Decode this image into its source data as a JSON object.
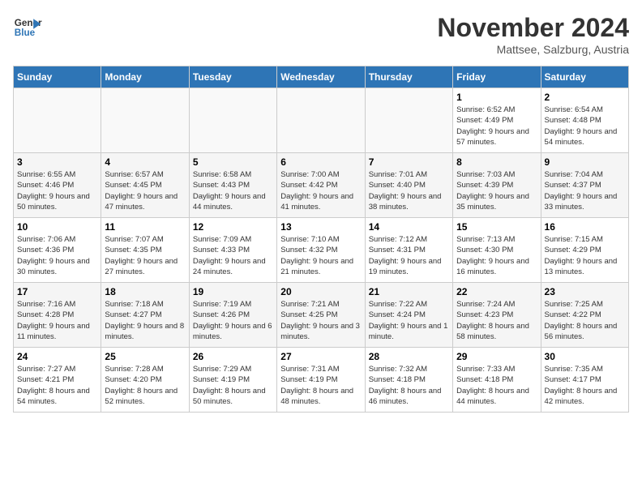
{
  "header": {
    "logo_line1": "General",
    "logo_line2": "Blue",
    "month_year": "November 2024",
    "location": "Mattsee, Salzburg, Austria"
  },
  "weekdays": [
    "Sunday",
    "Monday",
    "Tuesday",
    "Wednesday",
    "Thursday",
    "Friday",
    "Saturday"
  ],
  "weeks": [
    [
      {
        "day": "",
        "info": ""
      },
      {
        "day": "",
        "info": ""
      },
      {
        "day": "",
        "info": ""
      },
      {
        "day": "",
        "info": ""
      },
      {
        "day": "",
        "info": ""
      },
      {
        "day": "1",
        "info": "Sunrise: 6:52 AM\nSunset: 4:49 PM\nDaylight: 9 hours and 57 minutes."
      },
      {
        "day": "2",
        "info": "Sunrise: 6:54 AM\nSunset: 4:48 PM\nDaylight: 9 hours and 54 minutes."
      }
    ],
    [
      {
        "day": "3",
        "info": "Sunrise: 6:55 AM\nSunset: 4:46 PM\nDaylight: 9 hours and 50 minutes."
      },
      {
        "day": "4",
        "info": "Sunrise: 6:57 AM\nSunset: 4:45 PM\nDaylight: 9 hours and 47 minutes."
      },
      {
        "day": "5",
        "info": "Sunrise: 6:58 AM\nSunset: 4:43 PM\nDaylight: 9 hours and 44 minutes."
      },
      {
        "day": "6",
        "info": "Sunrise: 7:00 AM\nSunset: 4:42 PM\nDaylight: 9 hours and 41 minutes."
      },
      {
        "day": "7",
        "info": "Sunrise: 7:01 AM\nSunset: 4:40 PM\nDaylight: 9 hours and 38 minutes."
      },
      {
        "day": "8",
        "info": "Sunrise: 7:03 AM\nSunset: 4:39 PM\nDaylight: 9 hours and 35 minutes."
      },
      {
        "day": "9",
        "info": "Sunrise: 7:04 AM\nSunset: 4:37 PM\nDaylight: 9 hours and 33 minutes."
      }
    ],
    [
      {
        "day": "10",
        "info": "Sunrise: 7:06 AM\nSunset: 4:36 PM\nDaylight: 9 hours and 30 minutes."
      },
      {
        "day": "11",
        "info": "Sunrise: 7:07 AM\nSunset: 4:35 PM\nDaylight: 9 hours and 27 minutes."
      },
      {
        "day": "12",
        "info": "Sunrise: 7:09 AM\nSunset: 4:33 PM\nDaylight: 9 hours and 24 minutes."
      },
      {
        "day": "13",
        "info": "Sunrise: 7:10 AM\nSunset: 4:32 PM\nDaylight: 9 hours and 21 minutes."
      },
      {
        "day": "14",
        "info": "Sunrise: 7:12 AM\nSunset: 4:31 PM\nDaylight: 9 hours and 19 minutes."
      },
      {
        "day": "15",
        "info": "Sunrise: 7:13 AM\nSunset: 4:30 PM\nDaylight: 9 hours and 16 minutes."
      },
      {
        "day": "16",
        "info": "Sunrise: 7:15 AM\nSunset: 4:29 PM\nDaylight: 9 hours and 13 minutes."
      }
    ],
    [
      {
        "day": "17",
        "info": "Sunrise: 7:16 AM\nSunset: 4:28 PM\nDaylight: 9 hours and 11 minutes."
      },
      {
        "day": "18",
        "info": "Sunrise: 7:18 AM\nSunset: 4:27 PM\nDaylight: 9 hours and 8 minutes."
      },
      {
        "day": "19",
        "info": "Sunrise: 7:19 AM\nSunset: 4:26 PM\nDaylight: 9 hours and 6 minutes."
      },
      {
        "day": "20",
        "info": "Sunrise: 7:21 AM\nSunset: 4:25 PM\nDaylight: 9 hours and 3 minutes."
      },
      {
        "day": "21",
        "info": "Sunrise: 7:22 AM\nSunset: 4:24 PM\nDaylight: 9 hours and 1 minute."
      },
      {
        "day": "22",
        "info": "Sunrise: 7:24 AM\nSunset: 4:23 PM\nDaylight: 8 hours and 58 minutes."
      },
      {
        "day": "23",
        "info": "Sunrise: 7:25 AM\nSunset: 4:22 PM\nDaylight: 8 hours and 56 minutes."
      }
    ],
    [
      {
        "day": "24",
        "info": "Sunrise: 7:27 AM\nSunset: 4:21 PM\nDaylight: 8 hours and 54 minutes."
      },
      {
        "day": "25",
        "info": "Sunrise: 7:28 AM\nSunset: 4:20 PM\nDaylight: 8 hours and 52 minutes."
      },
      {
        "day": "26",
        "info": "Sunrise: 7:29 AM\nSunset: 4:19 PM\nDaylight: 8 hours and 50 minutes."
      },
      {
        "day": "27",
        "info": "Sunrise: 7:31 AM\nSunset: 4:19 PM\nDaylight: 8 hours and 48 minutes."
      },
      {
        "day": "28",
        "info": "Sunrise: 7:32 AM\nSunset: 4:18 PM\nDaylight: 8 hours and 46 minutes."
      },
      {
        "day": "29",
        "info": "Sunrise: 7:33 AM\nSunset: 4:18 PM\nDaylight: 8 hours and 44 minutes."
      },
      {
        "day": "30",
        "info": "Sunrise: 7:35 AM\nSunset: 4:17 PM\nDaylight: 8 hours and 42 minutes."
      }
    ]
  ]
}
